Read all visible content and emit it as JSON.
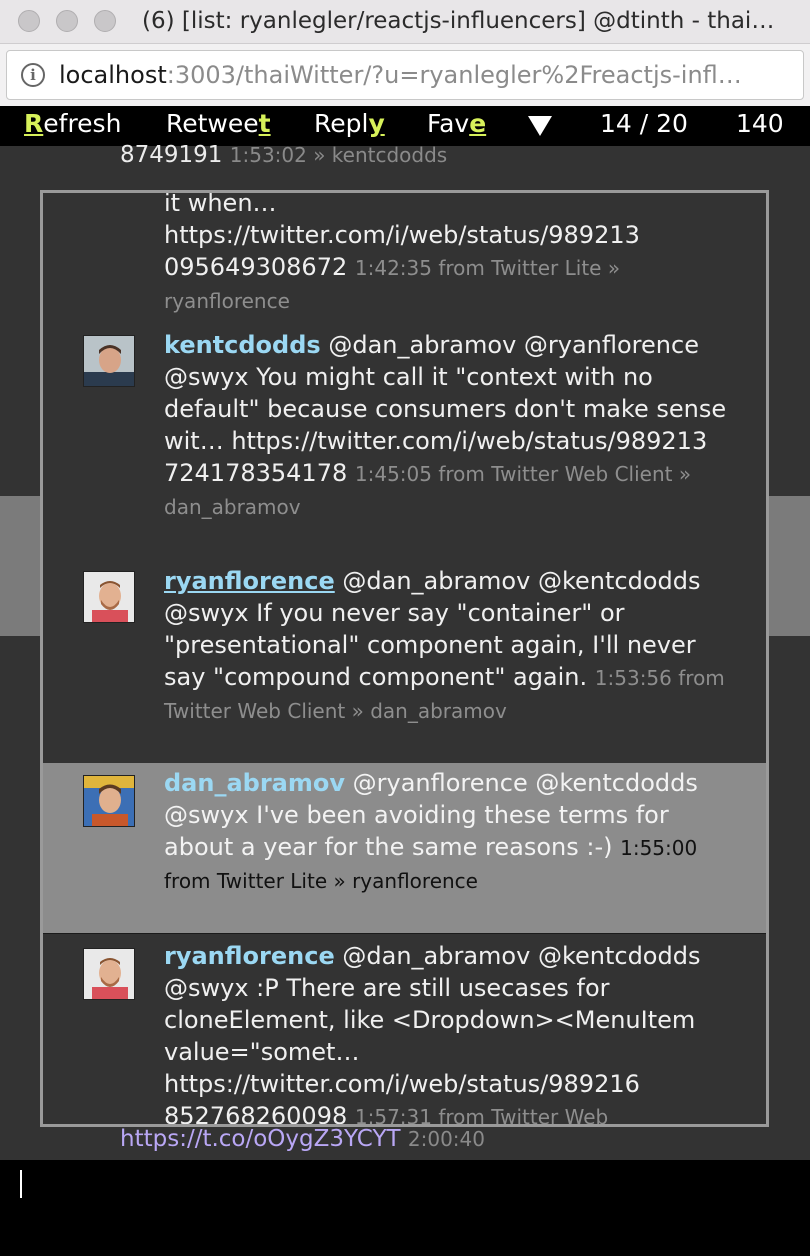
{
  "window": {
    "title": "(6) [list: ryanlegler/reactjs-influencers] @dtinth - thai…"
  },
  "address_bar": {
    "host": "localhost",
    "rest": ":3003/thaiWitter/?u=ryanlegler%2Freactjs-infl…"
  },
  "toolbar": {
    "refresh": {
      "key": "R",
      "rest": "efresh"
    },
    "retweet": {
      "pre": "Retwee",
      "key": "t"
    },
    "reply": {
      "pre": "Repl",
      "key": "y"
    },
    "fave": {
      "pre": "Fav",
      "key": "e"
    },
    "menu_icon": "triangle-down-icon",
    "counter": "14 / 20",
    "chars": "140"
  },
  "background_stream": {
    "top_line_id": "8749191",
    "top_line_meta": "1:53:02 » kentcdodds",
    "bottom_link": "https://t.co/oOygZ3YCYT",
    "bottom_time": "2:00:40"
  },
  "tweets": [
    {
      "user": "",
      "text": "it when… https://twitter.com/i/web/status/989213 095649308672",
      "meta": "1:42:35 from Twitter Lite » ryanflorence"
    },
    {
      "user": "kentcdodds",
      "text": " @dan_abramov @ryanflorence @swyx You might call it \"context with no default\" because consumers don't make sense wit… https://twitter.com/i/web/status/989213 724178354178",
      "meta": "1:45:05 from Twitter Web Client » dan_abramov"
    },
    {
      "user": "ryanflorence",
      "text": " @dan_abramov @kentcdodds @swyx If you never say \"container\" or \"presentational\" component again, I'll never say \"compound component\" again.",
      "meta": "1:53:56 from Twitter Web Client » dan_abramov"
    },
    {
      "user": "dan_abramov",
      "text": " @ryanflorence @kentcdodds @swyx I've been avoiding these terms for about a year for the same reasons :-)",
      "meta": "1:55:00 from Twitter Lite » ryanflorence"
    },
    {
      "user": "ryanflorence",
      "text": " @dan_abramov @kentcdodds @swyx :P There are still usecases for cloneElement, like <Dropdown><MenuItem value=\"somet… https://twitter.com/i/web/status/989216 852768260098",
      "meta": "1:57:31 from Twitter Web"
    }
  ]
}
